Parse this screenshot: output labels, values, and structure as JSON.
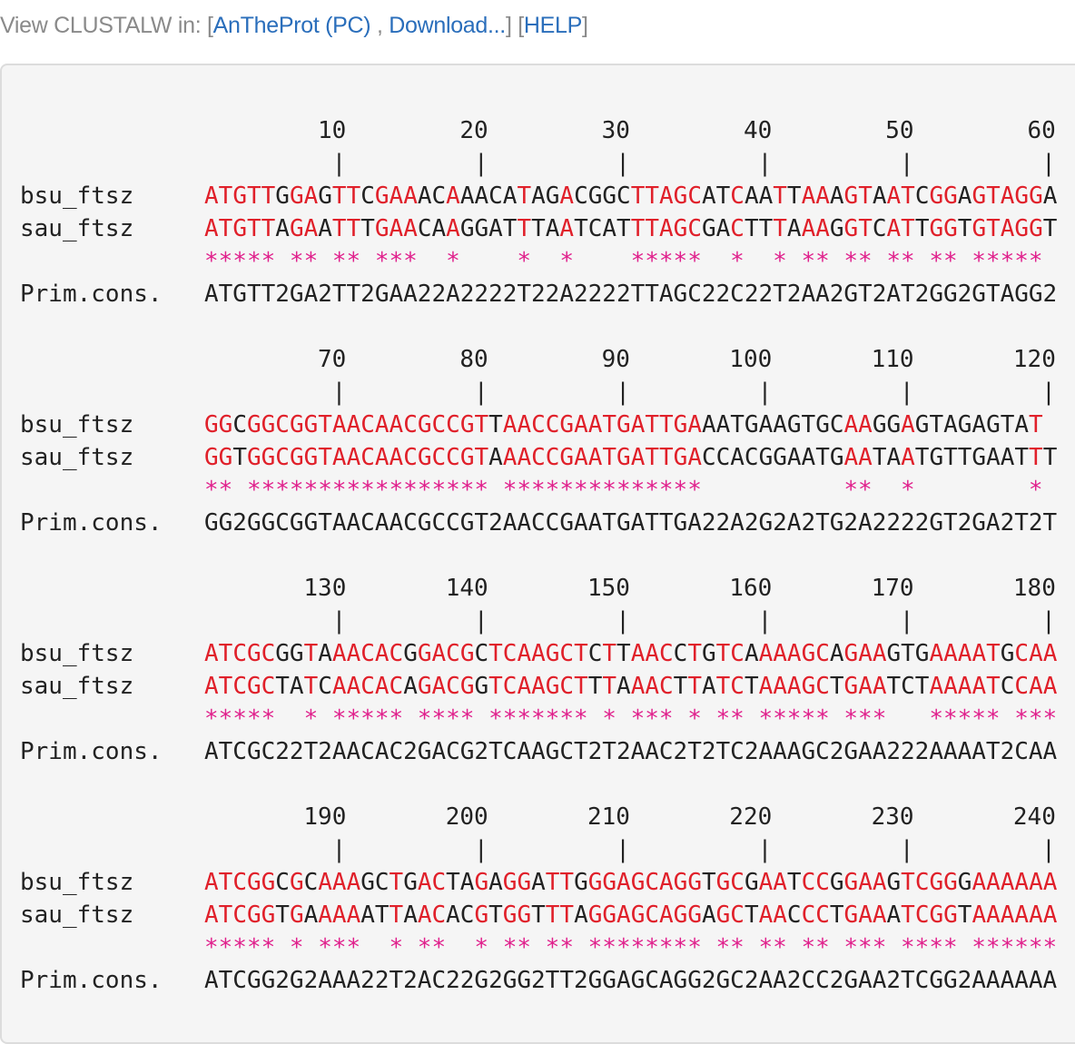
{
  "header": {
    "prefix": "View CLUSTALW in: [",
    "link_antheprot": "AnTheProt (PC)",
    "sep": " , ",
    "link_download": "Download...",
    "mid": "] [",
    "link_help": "HELP",
    "suffix": "]"
  },
  "names": {
    "seq1": "bsu_ftsz",
    "seq2": "sau_ftsz",
    "cons": "Prim.cons."
  },
  "blocks": [
    {
      "ticks": [
        "10",
        "20",
        "30",
        "40",
        "50",
        "60"
      ],
      "seq1": "ATGTTGGAGTTCGAAACAAACATAGACGGCTTAGCATCAATTAAAGTAATCGGAGTAGGA",
      "seq2": "ATGTTAGAATTTGAACAAGGATTTAATCATTTAGCGACTTTAAAGGTCATTGGTGTAGGT",
      "cons": "ATGTT2GA2TT2GAA22A2222T22A2222TTAGC22C22T2AA2GT2AT2GG2GTAGG2"
    },
    {
      "ticks": [
        "70",
        "80",
        "90",
        "100",
        "110",
        "120"
      ],
      "seq1": "GGCGGCGGTAACAACGCCGTTAACCGAATGATTGAAATGAAGTGCAAGGAGTAGAGTAT",
      "seq2": "GGTGGCGGTAACAACGCCGTAAACCGAATGATTGACCACGGAATGAATAATGTTGAATTT",
      "cons": "GG2GGCGGTAACAACGCCGT2AACCGAATGATTGA22A2G2A2TG2A2222GT2GA2T2T"
    },
    {
      "ticks": [
        "130",
        "140",
        "150",
        "160",
        "170",
        "180"
      ],
      "seq1": "ATCGCGGTAAACACGGACGCTCAAGCTCTTAACCTGTCAAAAGCAGAAGTGAAAATGCAA",
      "seq2": "ATCGCTATCAACACAGACGGTCAAGCTTTAAACTTATCTAAAGCTGAATCTAAAATCCAA",
      "cons": "ATCGC22T2AACAC2GACG2TCAAGCT2T2AAC2T2TC2AAAGC2GAA222AAAAT2CAA"
    },
    {
      "ticks": [
        "190",
        "200",
        "210",
        "220",
        "230",
        "240"
      ],
      "seq1": "ATCGGCGCAAAGCTGACTAGAGGATTGGGAGCAGGTGCGAATCCGGAAGTCGGGAAAAAA",
      "seq2": "ATCGGTGAAAAATTAACACGTGGTTTAGGAGCAGGAGCTAACCCTGAAATCGGTAAAAAA",
      "cons": "ATCGG2G2AAA22T2AC22G2GG2TT2GGAGCAGG2GC2AA2CC2GAA2TCGG2AAAAAA"
    }
  ]
}
